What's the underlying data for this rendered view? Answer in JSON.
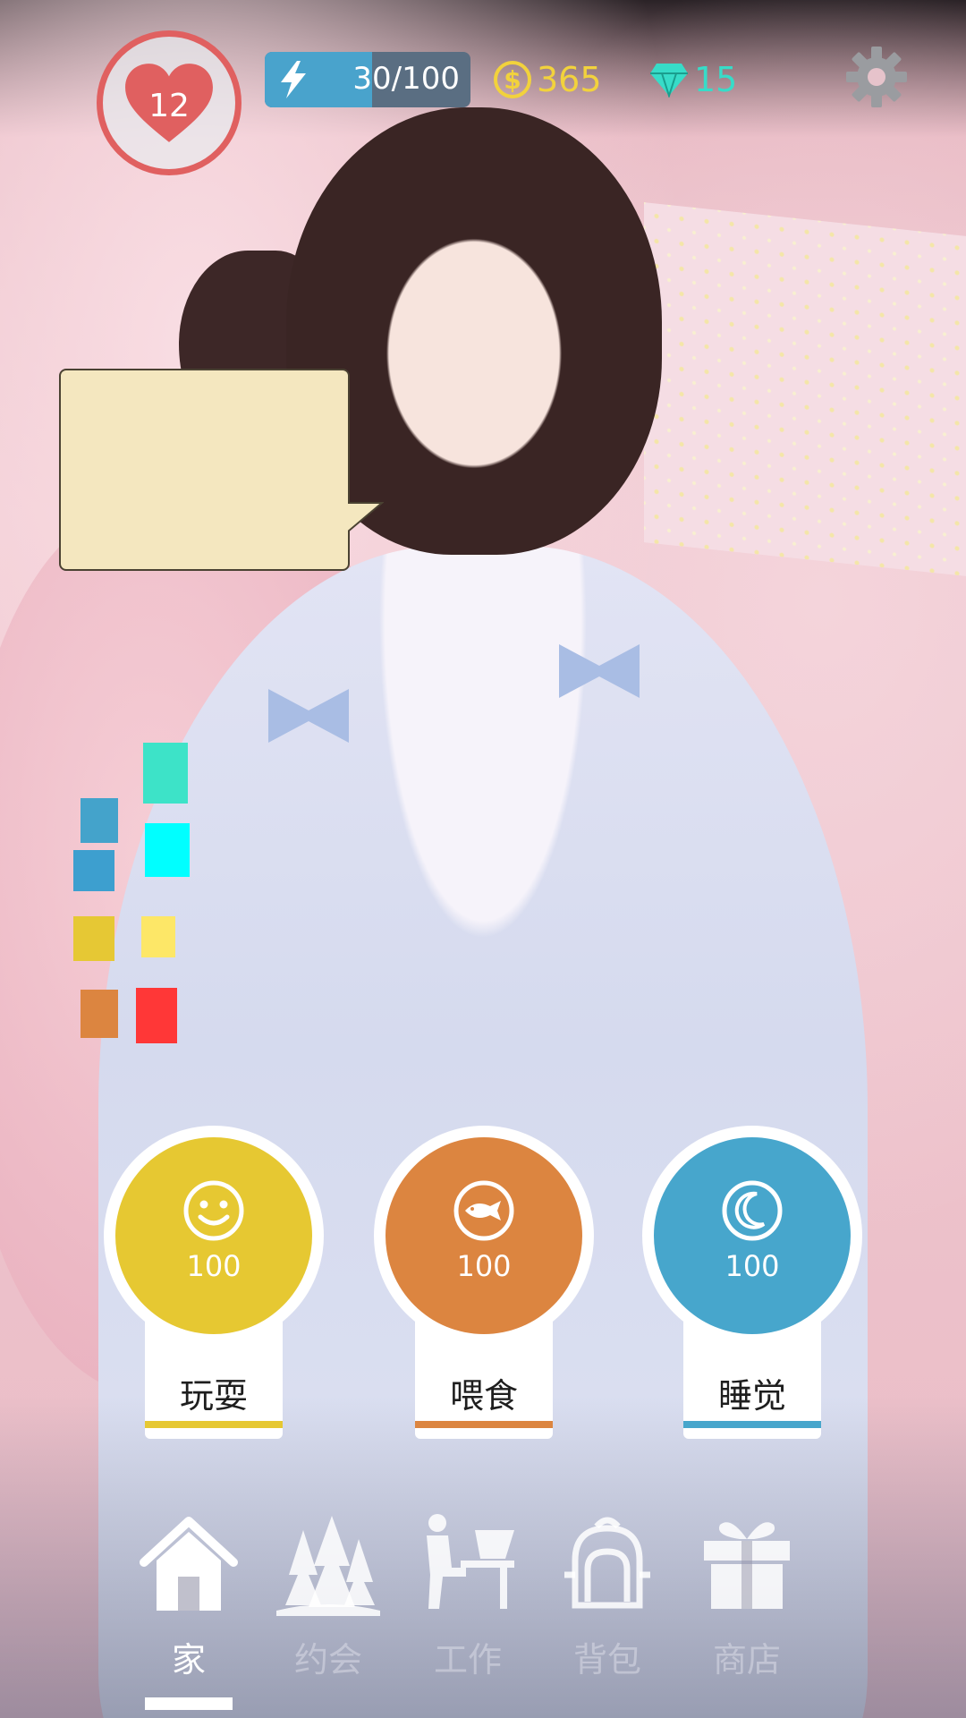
{
  "hud": {
    "level": "12",
    "energy_text": "30/100",
    "energy_fraction": 0.52,
    "coins": "365",
    "coin_symbol": "$",
    "gems": "15",
    "icons": [
      "heart-icon",
      "lightning-icon",
      "coin-icon",
      "gem-icon",
      "gear-icon"
    ]
  },
  "speech_bubble": {
    "text": ""
  },
  "stat_squares": {
    "colors": [
      "#3de3c8",
      "#44a3cb",
      "#00ffff",
      "#3d9fcf",
      "#e6c834",
      "#fde767",
      "#dc8540",
      "#ff3737"
    ]
  },
  "actions": [
    {
      "label": "玩耍",
      "value": "100",
      "icon": "smiley-icon",
      "color": "#e6c832"
    },
    {
      "label": "喂食",
      "value": "100",
      "icon": "fish-icon",
      "color": "#dc8540"
    },
    {
      "label": "睡觉",
      "value": "100",
      "icon": "moon-icon",
      "color": "#47a6cc"
    }
  ],
  "nav": [
    {
      "label": "家",
      "icon": "home-icon",
      "active": true
    },
    {
      "label": "约会",
      "icon": "trees-icon",
      "active": false
    },
    {
      "label": "工作",
      "icon": "desk-icon",
      "active": false
    },
    {
      "label": "背包",
      "icon": "backpack-icon",
      "active": false
    },
    {
      "label": "商店",
      "icon": "gift-icon",
      "active": false
    }
  ]
}
